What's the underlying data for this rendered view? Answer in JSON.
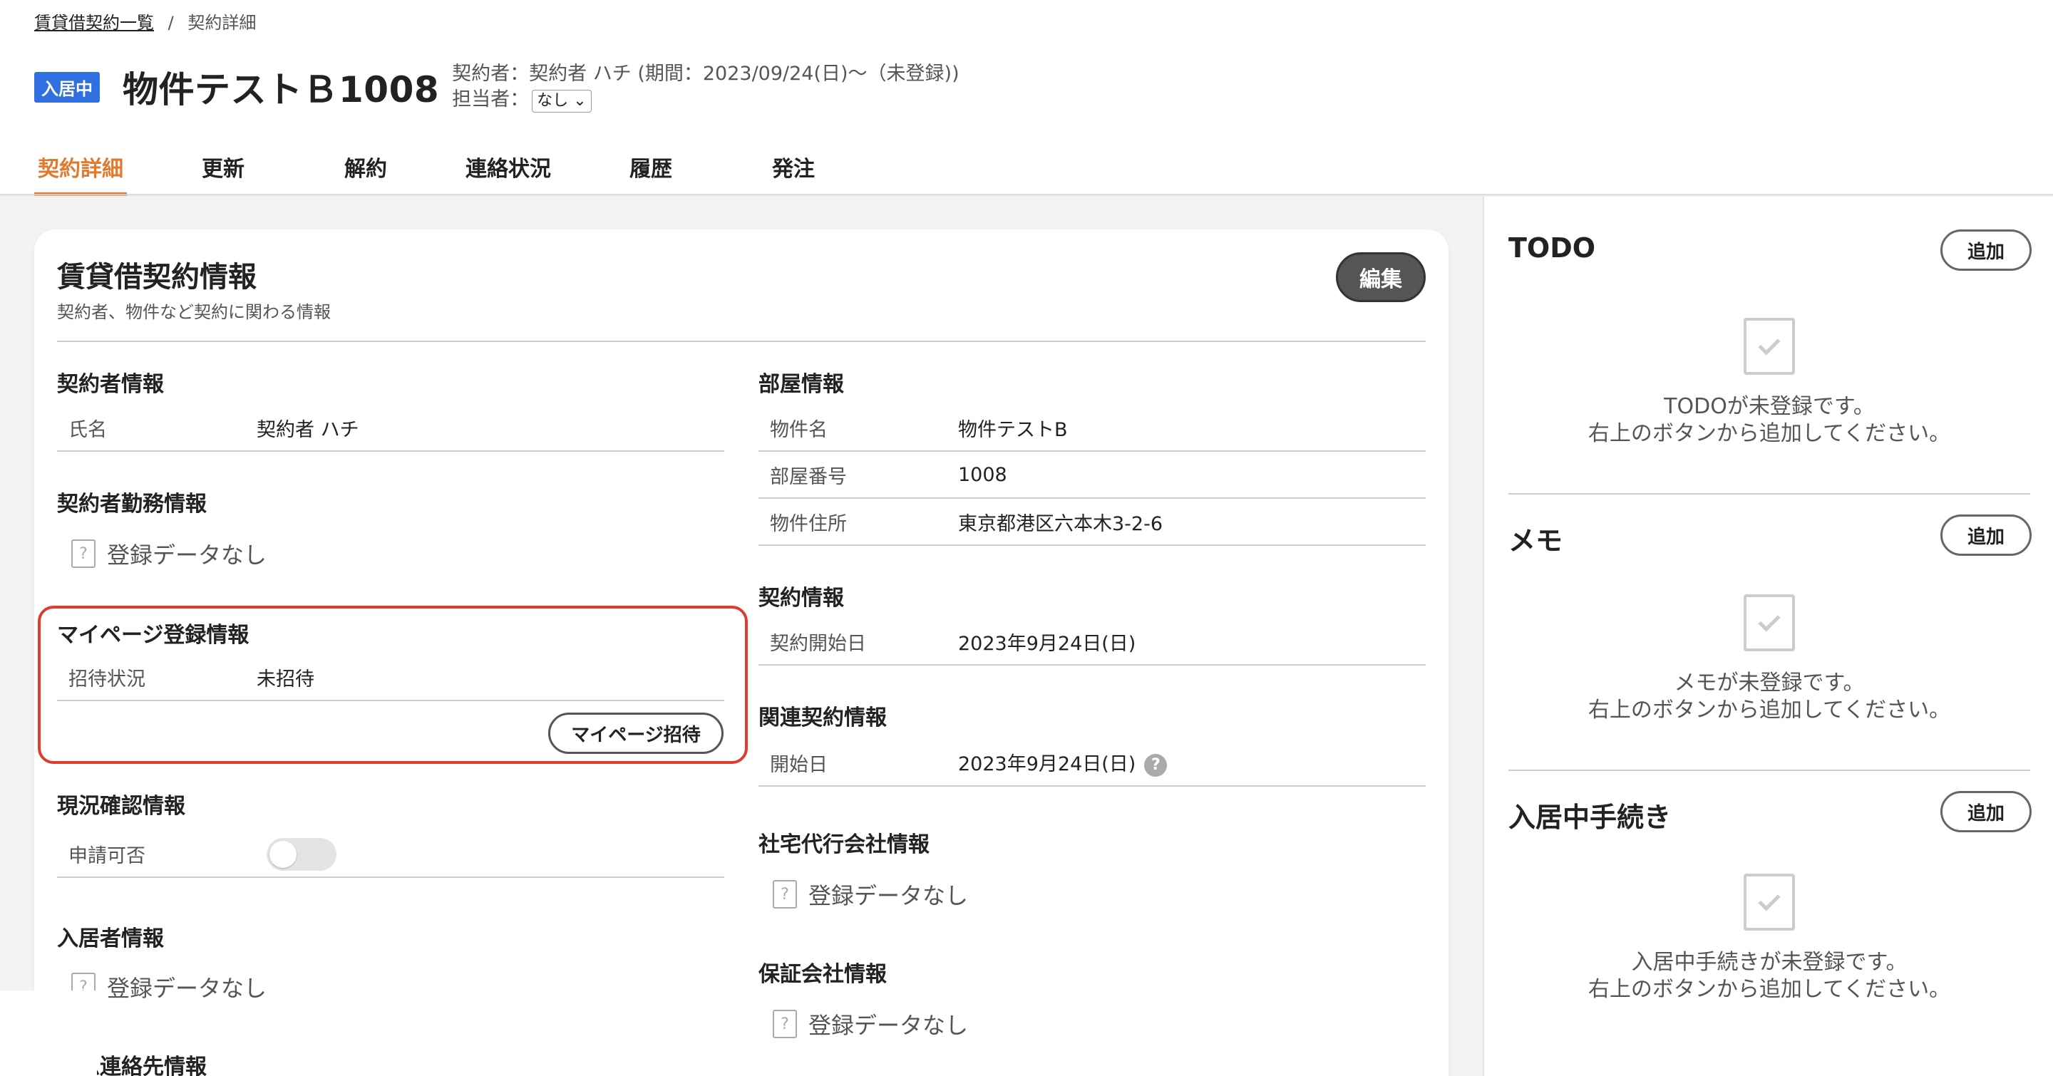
{
  "breadcrumb": {
    "parent": "賃貸借契約一覧",
    "separator": "/",
    "current": "契約詳細"
  },
  "header": {
    "status_badge": "入居中",
    "title": "物件テストＢ1008",
    "contract_line": "契約者：契約者 ハチ (期間：2023/09/24(日)〜（未登録))",
    "assignee_label": "担当者：",
    "assignee_value": "なし"
  },
  "tabs": [
    {
      "label": "契約詳細",
      "active": true
    },
    {
      "label": "更新"
    },
    {
      "label": "解約"
    },
    {
      "label": "連絡状況"
    },
    {
      "label": "履歴"
    },
    {
      "label": "発注"
    }
  ],
  "card": {
    "title": "賃貸借契約情報",
    "subtitle": "契約者、物件など契約に関わる情報",
    "edit_label": "編集"
  },
  "left": {
    "contractor_title": "契約者情報",
    "contractor_rows": [
      {
        "k": "氏名",
        "v": "契約者 ハチ"
      }
    ],
    "work_title": "契約者勤務情報",
    "nodata": "登録データなし",
    "mypage_title": "マイページ登録情報",
    "mypage_rows": [
      {
        "k": "招待状況",
        "v": "未招待"
      }
    ],
    "mypage_invite_label": "マイページ招待",
    "status_check_title": "現況確認情報",
    "status_check_row_label": "申請可否",
    "resident_title": "入居者情報",
    "emergency_title": "緊急連絡先情報"
  },
  "right": {
    "room_title": "部屋情報",
    "room_rows": [
      {
        "k": "物件名",
        "v": "物件テストB"
      },
      {
        "k": "部屋番号",
        "v": "1008"
      },
      {
        "k": "物件住所",
        "v": "東京都港区六本木3-2-6"
      }
    ],
    "contract_title": "契約情報",
    "contract_rows": [
      {
        "k": "契約開始日",
        "v": "2023年9月24日(日)"
      }
    ],
    "related_title": "関連契約情報",
    "related_rows": [
      {
        "k": "開始日",
        "v": "2023年9月24日(日)"
      }
    ],
    "agency_title": "社宅代行会社情報",
    "guarantee_title": "保証会社情報",
    "nodata": "登録データなし"
  },
  "sidebar": {
    "todo": {
      "title": "TODO",
      "add_label": "追加",
      "empty_line1": "TODOが未登録です。",
      "empty_line2": "右上のボタンから追加してください。"
    },
    "memo": {
      "title": "メモ",
      "add_label": "追加",
      "empty_line1": "メモが未登録です。",
      "empty_line2": "右上のボタンから追加してください。"
    },
    "procedure": {
      "title": "入居中手続き",
      "add_label": "追加",
      "empty_line1": "入居中手続きが未登録です。",
      "empty_line2": "右上のボタンから追加してください。"
    }
  },
  "colors": {
    "accent": "#e07a2f",
    "badge": "#2f6fdf",
    "highlight": "#e03c2c"
  }
}
